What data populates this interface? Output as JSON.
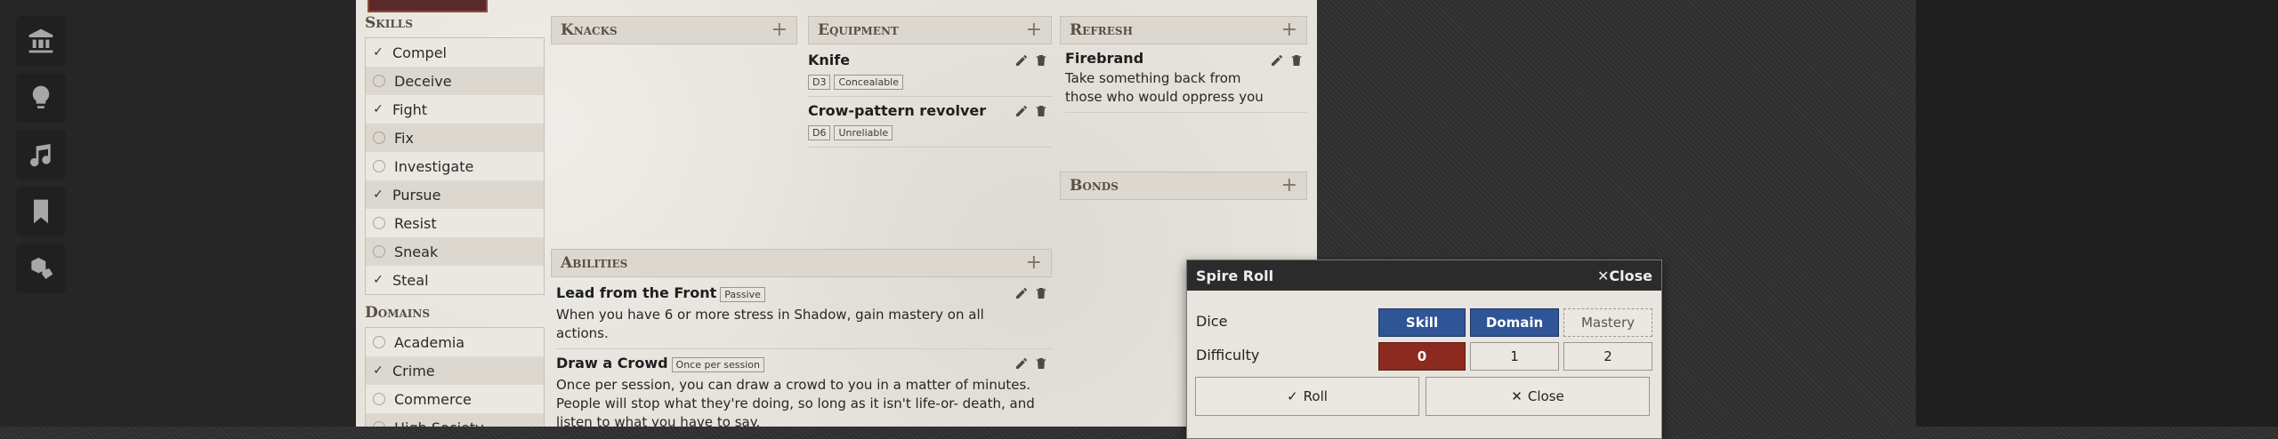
{
  "sidebar": [
    {
      "icon": "bank-icon"
    },
    {
      "icon": "lightbulb-icon"
    },
    {
      "icon": "music-icon"
    },
    {
      "icon": "bookmark-icon"
    },
    {
      "icon": "dice-icon"
    }
  ],
  "skills": {
    "title": "Skills",
    "items": [
      {
        "label": "Compel",
        "checked": true
      },
      {
        "label": "Deceive",
        "checked": false
      },
      {
        "label": "Fight",
        "checked": true
      },
      {
        "label": "Fix",
        "checked": false
      },
      {
        "label": "Investigate",
        "checked": false
      },
      {
        "label": "Pursue",
        "checked": true
      },
      {
        "label": "Resist",
        "checked": false
      },
      {
        "label": "Sneak",
        "checked": false
      },
      {
        "label": "Steal",
        "checked": true
      }
    ]
  },
  "domains": {
    "title": "Domains",
    "items": [
      {
        "label": "Academia",
        "checked": false
      },
      {
        "label": "Crime",
        "checked": true
      },
      {
        "label": "Commerce",
        "checked": false
      },
      {
        "label": "High Society",
        "checked": false
      }
    ]
  },
  "knacks": {
    "title": "Knacks"
  },
  "equipment": {
    "title": "Equipment",
    "items": [
      {
        "name": "Knife",
        "tags": [
          "D3",
          "Concealable"
        ]
      },
      {
        "name": "Crow-pattern revolver",
        "tags": [
          "D6",
          "Unreliable"
        ]
      }
    ]
  },
  "refresh": {
    "title": "Refresh",
    "items": [
      {
        "name": "Firebrand",
        "desc": "Take something back from those who would oppress you"
      }
    ]
  },
  "bonds": {
    "title": "Bonds"
  },
  "abilities": {
    "title": "Abilities",
    "items": [
      {
        "name": "Lead from the Front",
        "tag": "Passive",
        "desc": "When you have 6 or more stress in Shadow, gain mastery on all actions."
      },
      {
        "name": "Draw a Crowd",
        "tag": "Once per session",
        "desc": "Once per session, you can draw a crowd to you in a matter of minutes. People will stop what they're doing, so long as it isn't life-or- death, and listen to what you have to say."
      }
    ]
  },
  "dialog": {
    "title": "Spire Roll",
    "close_label": "Close",
    "dice_label": "Dice",
    "difficulty_label": "Difficulty",
    "dice_options": [
      "Skill",
      "Domain",
      "Mastery"
    ],
    "difficulty_options": [
      "0",
      "1",
      "2"
    ],
    "roll_label": "Roll",
    "cancel_label": "Close"
  }
}
